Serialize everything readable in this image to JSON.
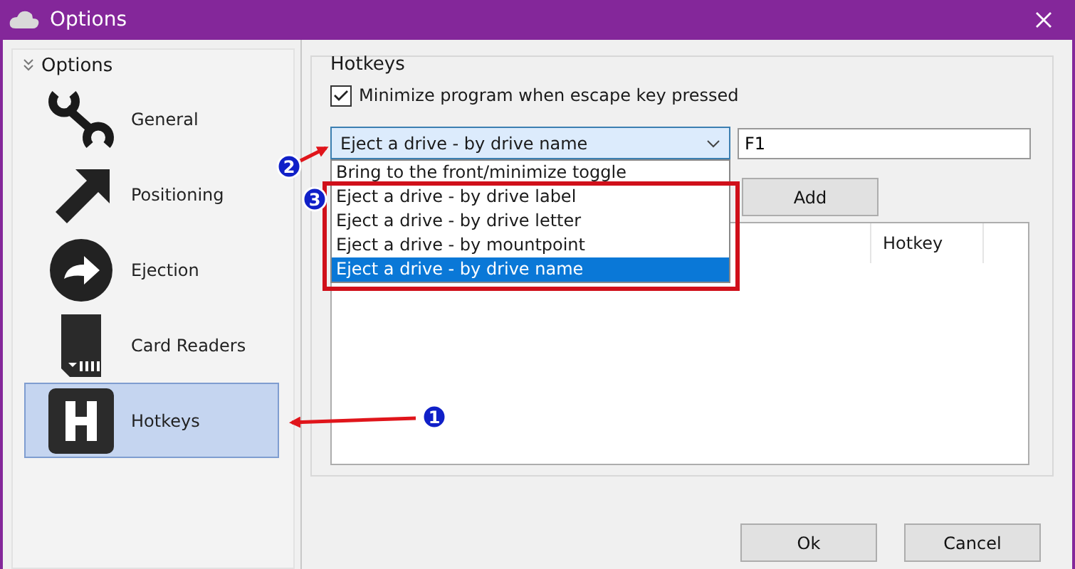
{
  "window": {
    "title": "Options"
  },
  "sidebar": {
    "header": "Options",
    "items": [
      {
        "label": "General",
        "kind": "wrench",
        "selected": false
      },
      {
        "label": "Positioning",
        "kind": "arrow",
        "selected": false
      },
      {
        "label": "Ejection",
        "kind": "eject",
        "selected": false
      },
      {
        "label": "Card Readers",
        "kind": "card",
        "selected": false
      },
      {
        "label": "Hotkeys",
        "kind": "letter",
        "selected": true
      }
    ]
  },
  "hotkeys": {
    "title": "Hotkeys",
    "minimize_checkbox": {
      "label": "Minimize program when escape key pressed",
      "checked": true
    },
    "action_combo": {
      "value": "Eject a drive - by drive name",
      "expanded": true,
      "options": [
        {
          "label": "Bring to the front/minimize toggle",
          "selected": false
        },
        {
          "label": "Eject a drive - by drive label",
          "selected": false
        },
        {
          "label": "Eject a drive - by drive letter",
          "selected": false
        },
        {
          "label": "Eject a drive - by mountpoint",
          "selected": false
        },
        {
          "label": "Eject a drive - by drive name",
          "selected": true
        }
      ]
    },
    "key_field": {
      "value": "F1"
    },
    "add_button": "Add",
    "table": {
      "columns": [
        {
          "label": "Hotkey"
        }
      ]
    }
  },
  "buttons": [
    "Ok",
    "Cancel"
  ],
  "annotations": [
    {
      "kind": "arrow",
      "number": "1"
    },
    {
      "kind": "arrow",
      "number": "2"
    },
    {
      "kind": "box",
      "number": "3"
    }
  ]
}
